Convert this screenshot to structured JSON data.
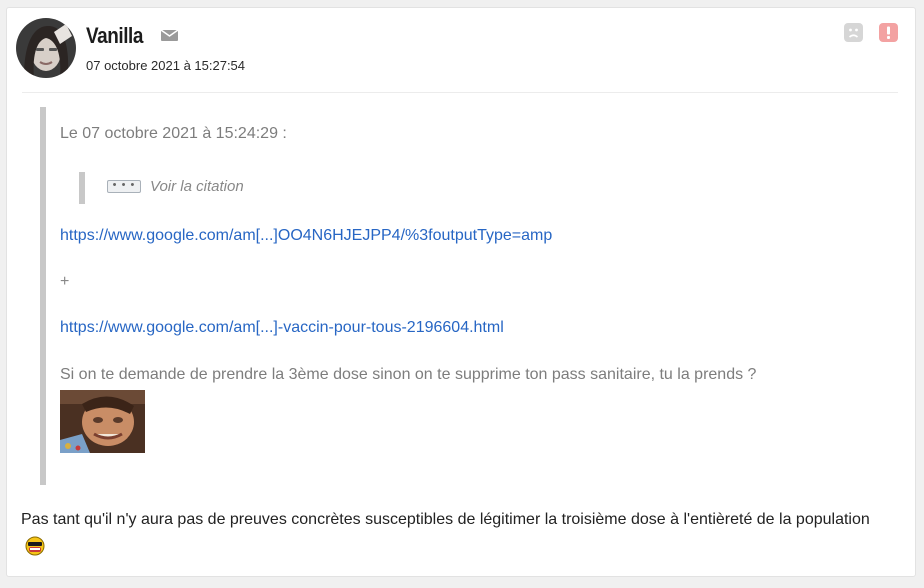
{
  "author": {
    "pseudo": "Vanilla",
    "date": "07 octobre 2021 à 15:27:54",
    "avatar_icon": "avatar-icon",
    "mail_icon": "mail-icon"
  },
  "actions": {
    "sad_icon": "sad-face-icon",
    "alert_icon": "alert-icon",
    "alert_color": "#f3a2a2"
  },
  "quote": {
    "header": "Le 07 octobre 2021 à 15:24:29 :",
    "nested_button": "• • •",
    "nested_label": "Voir la citation",
    "link1": "https://www.google.com/am[...]OO4N6HJEJPP4/%3foutputType=amp",
    "separator": "+",
    "link2": "https://www.google.com/am[...]-vaccin-pour-tous-2196604.html",
    "question": "Si on te demande de prendre la 3ème dose sinon on te supprime ton pass sanitaire, tu la prends ?",
    "image_icon": "sticker-image"
  },
  "reply": {
    "text": "Pas tant qu'il n'y aura pas de preuves concrètes susceptibles de légitimer la troisième dose à l'entièreté de la population",
    "smiley_icon": "sunglasses-smiley-icon"
  },
  "colors": {
    "link": "#2766c4",
    "quote_bar": "#c8c8c8"
  }
}
